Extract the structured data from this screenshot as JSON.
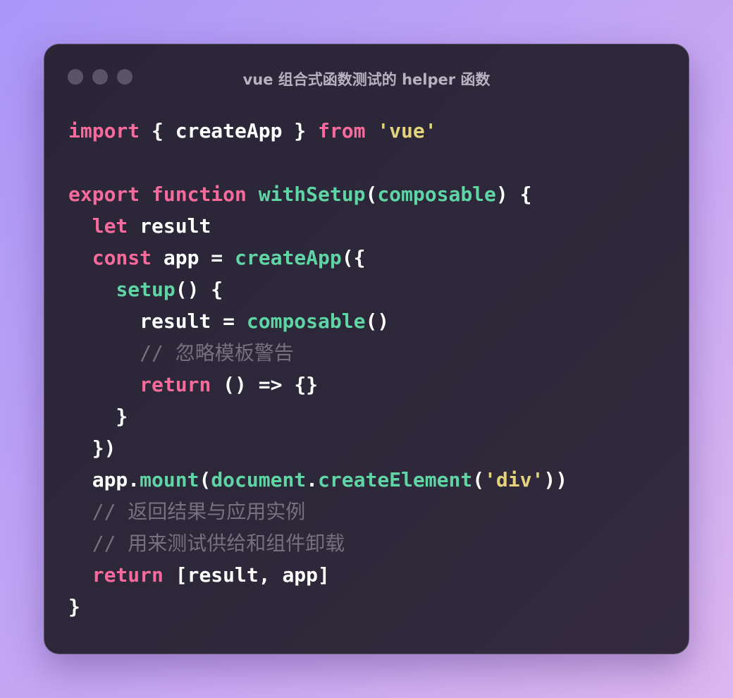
{
  "window": {
    "title": "vue 组合式函数测试的 helper 函数",
    "controls": [
      "close",
      "minimize",
      "maximize"
    ]
  },
  "code": {
    "language": "javascript",
    "lines": [
      [
        {
          "t": "import",
          "c": "kw"
        },
        {
          "t": " { createApp } ",
          "c": "pl"
        },
        {
          "t": "from",
          "c": "kw"
        },
        {
          "t": " ",
          "c": "pl"
        },
        {
          "t": "'vue'",
          "c": "str"
        }
      ],
      [],
      [
        {
          "t": "export",
          "c": "kw"
        },
        {
          "t": " ",
          "c": "pl"
        },
        {
          "t": "function",
          "c": "kw"
        },
        {
          "t": " ",
          "c": "pl"
        },
        {
          "t": "withSetup",
          "c": "fn"
        },
        {
          "t": "(",
          "c": "pl"
        },
        {
          "t": "composable",
          "c": "fn"
        },
        {
          "t": ") {",
          "c": "pl"
        }
      ],
      [
        {
          "t": "  ",
          "c": "pl"
        },
        {
          "t": "let",
          "c": "kw"
        },
        {
          "t": " result",
          "c": "pl"
        }
      ],
      [
        {
          "t": "  ",
          "c": "pl"
        },
        {
          "t": "const",
          "c": "kw"
        },
        {
          "t": " app = ",
          "c": "pl"
        },
        {
          "t": "createApp",
          "c": "fn"
        },
        {
          "t": "({",
          "c": "pl"
        }
      ],
      [
        {
          "t": "    ",
          "c": "pl"
        },
        {
          "t": "setup",
          "c": "fn"
        },
        {
          "t": "() {",
          "c": "pl"
        }
      ],
      [
        {
          "t": "      result = ",
          "c": "pl"
        },
        {
          "t": "composable",
          "c": "fn"
        },
        {
          "t": "()",
          "c": "pl"
        }
      ],
      [
        {
          "t": "      ",
          "c": "pl"
        },
        {
          "t": "// 忽略模板警告",
          "c": "cm"
        }
      ],
      [
        {
          "t": "      ",
          "c": "pl"
        },
        {
          "t": "return",
          "c": "kw"
        },
        {
          "t": " () => {}",
          "c": "pl"
        }
      ],
      [
        {
          "t": "    }",
          "c": "pl"
        }
      ],
      [
        {
          "t": "  })",
          "c": "pl"
        }
      ],
      [
        {
          "t": "  app.",
          "c": "pl"
        },
        {
          "t": "mount",
          "c": "fn"
        },
        {
          "t": "(",
          "c": "pl"
        },
        {
          "t": "document",
          "c": "fn"
        },
        {
          "t": ".",
          "c": "pl"
        },
        {
          "t": "createElement",
          "c": "fn"
        },
        {
          "t": "(",
          "c": "pl"
        },
        {
          "t": "'div'",
          "c": "str"
        },
        {
          "t": "))",
          "c": "pl"
        }
      ],
      [
        {
          "t": "  ",
          "c": "pl"
        },
        {
          "t": "// 返回结果与应用实例",
          "c": "cm"
        }
      ],
      [
        {
          "t": "  ",
          "c": "pl"
        },
        {
          "t": "// 用来测试供给和组件卸载",
          "c": "cm"
        }
      ],
      [
        {
          "t": "  ",
          "c": "pl"
        },
        {
          "t": "return",
          "c": "kw"
        },
        {
          "t": " [result, app]",
          "c": "pl"
        }
      ],
      [
        {
          "t": "}",
          "c": "pl"
        }
      ]
    ]
  },
  "colors": {
    "keyword": "#f76a9c",
    "function": "#5fd4a4",
    "string": "#e3d37c",
    "comment": "#76707f",
    "plain": "#ffffff",
    "window_bg": "#2a2638"
  }
}
